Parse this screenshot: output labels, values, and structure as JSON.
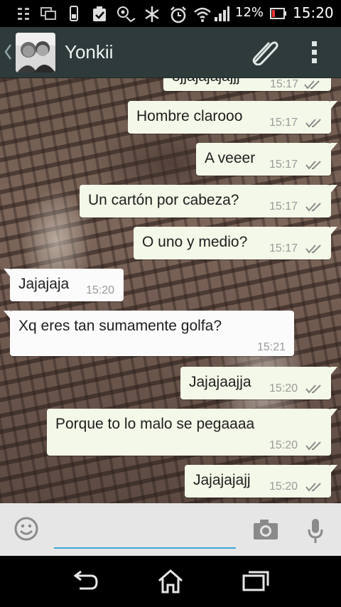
{
  "status_bar": {
    "battery_percent": "12%",
    "time": "15:20",
    "icons": [
      "usb-debug-icon",
      "screen-icon",
      "phone-icon",
      "clipboard-check-icon",
      "headset-icon",
      "bluetooth-icon",
      "alarm-icon",
      "wifi-icon",
      "signal-icon",
      "battery-icon"
    ]
  },
  "header": {
    "contact_name": "Yonkii",
    "icons": [
      "back-chevron-icon",
      "paperclip-icon",
      "overflow-menu-icon"
    ]
  },
  "messages": [
    {
      "direction": "out",
      "text": "ojjajajajajjj",
      "time": "15:17",
      "status": "read"
    },
    {
      "direction": "out",
      "text": "Hombre clarooo",
      "time": "15:17",
      "status": "read"
    },
    {
      "direction": "out",
      "text": "A veeer",
      "time": "15:17",
      "status": "read"
    },
    {
      "direction": "out",
      "text": "Un cartón por cabeza?",
      "time": "15:17",
      "status": "read"
    },
    {
      "direction": "out",
      "text": "O uno y medio?",
      "time": "15:17",
      "status": "read"
    },
    {
      "direction": "in",
      "text": "Jajajaja",
      "time": "15:20"
    },
    {
      "direction": "in",
      "text": "Xq eres tan sumamente golfa?",
      "time": "15:21"
    },
    {
      "direction": "out",
      "text": "Jajajaajja",
      "time": "15:20",
      "status": "read"
    },
    {
      "direction": "out",
      "text": "Porque to lo malo se pegaaaa",
      "time": "15:20",
      "status": "read"
    },
    {
      "direction": "out",
      "text": "Jajajajajj",
      "time": "15:20",
      "status": "read"
    }
  ],
  "input_bar": {
    "message_value": "",
    "icons": [
      "emoji-icon",
      "camera-icon",
      "microphone-icon"
    ]
  },
  "nav_bar": {
    "icons": [
      "back-icon",
      "home-icon",
      "recent-apps-icon"
    ]
  },
  "colors": {
    "header_bg": "#2f3a3b",
    "outgoing_bubble": "#f4f8e8",
    "incoming_bubble": "#fbfbfb",
    "input_underline": "#3aa9d6",
    "read_ticks": "#8a8a8a"
  }
}
